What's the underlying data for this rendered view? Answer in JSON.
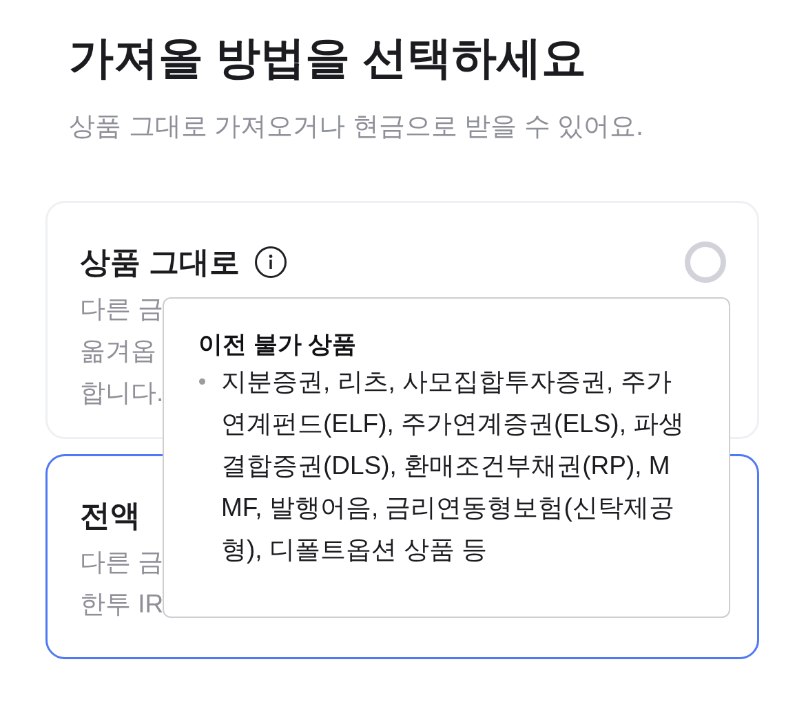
{
  "title": "가져올 방법을 선택하세요",
  "subtitle": "상품 그대로 가져오거나 현금으로 받을 수 있어요.",
  "cards": [
    {
      "title": "상품 그대로",
      "info_icon": true,
      "radio": true,
      "selected": false,
      "description_lines": [
        "다른 금",
        "옮겨옵",
        "합니다."
      ]
    },
    {
      "title": "전액",
      "selected": true,
      "description_lines": [
        "다른 금",
        "한투 IR"
      ]
    }
  ],
  "tooltip": {
    "title": "이전 불가 상품",
    "bullets": [
      {
        "lines": [
          "지분증권, 리츠, 사모집합투자증권, 주가",
          "연계펀드(ELF), 주가연계증권(ELS), 파생",
          "결합증권(DLS), 환매조건부채권(RP), M",
          "MF, 발행어음, 금리연동형보험(신탁제공",
          "형), 디폴트옵션 상품 등"
        ]
      }
    ]
  }
}
